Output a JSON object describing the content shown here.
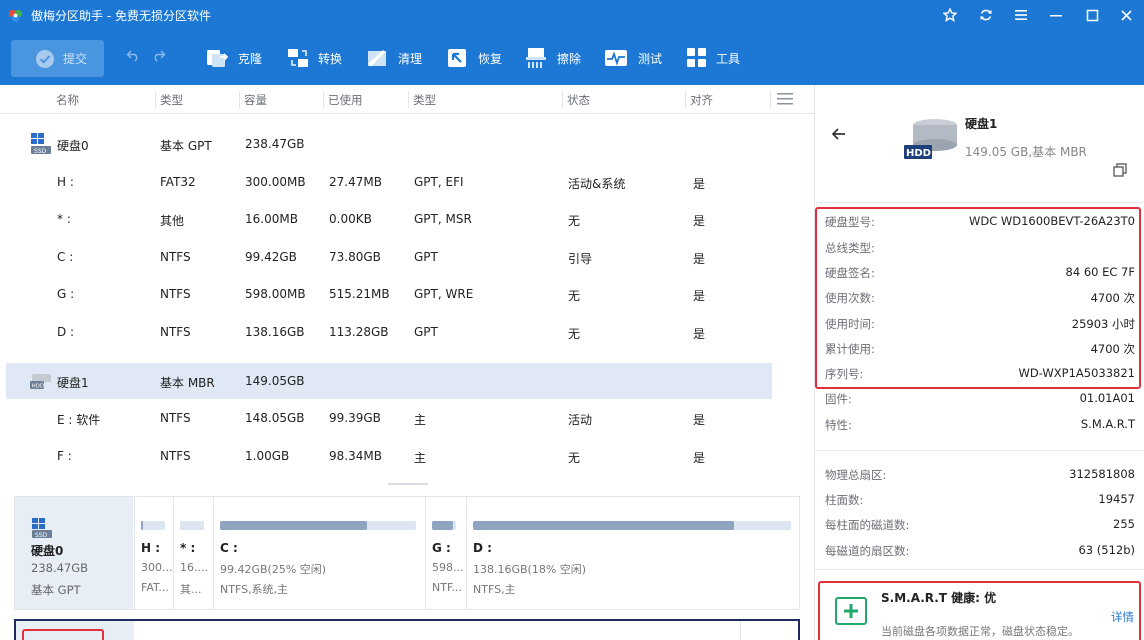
{
  "app": {
    "title": "傲梅分区助手 - 免费无损分区软件"
  },
  "colors": {
    "accent": "#1c78d4",
    "selected_row": "#dfe8f4",
    "highlight_red": "#e0303b",
    "smart_green": "#23a86b"
  },
  "toolbar": {
    "commit_label": "提交",
    "items": [
      {
        "label": "克隆",
        "icon": "clone-icon"
      },
      {
        "label": "转换",
        "icon": "convert-icon"
      },
      {
        "label": "清理",
        "icon": "cleanup-icon"
      },
      {
        "label": "恢复",
        "icon": "recover-icon"
      },
      {
        "label": "擦除",
        "icon": "wipe-icon"
      },
      {
        "label": "测试",
        "icon": "test-icon"
      },
      {
        "label": "工具",
        "icon": "tools-icon"
      }
    ]
  },
  "table": {
    "headers": [
      "名称",
      "类型",
      "容量",
      "已使用",
      "类型",
      "状态",
      "对齐"
    ],
    "rows": [
      {
        "name": "硬盘0",
        "type": "基本 GPT",
        "cap": "238.47GB",
        "used": "",
        "ptype": "",
        "status": "",
        "align": "",
        "disk": "ssd"
      },
      {
        "name": "H :",
        "type": "FAT32",
        "cap": "300.00MB",
        "used": "27.47MB",
        "ptype": "GPT, EFI",
        "status": "活动&系统",
        "align": "是"
      },
      {
        "name": "* :",
        "type": "其他",
        "cap": "16.00MB",
        "used": "0.00KB",
        "ptype": "GPT, MSR",
        "status": "无",
        "align": "是"
      },
      {
        "name": "C :",
        "type": "NTFS",
        "cap": "99.42GB",
        "used": "73.80GB",
        "ptype": "GPT",
        "status": "引导",
        "align": "是"
      },
      {
        "name": "G :",
        "type": "NTFS",
        "cap": "598.00MB",
        "used": "515.21MB",
        "ptype": "GPT, WRE",
        "status": "无",
        "align": "是"
      },
      {
        "name": "D :",
        "type": "NTFS",
        "cap": "138.16GB",
        "used": "113.28GB",
        "ptype": "GPT",
        "status": "无",
        "align": "是"
      },
      {
        "name": "硬盘1",
        "type": "基本 MBR",
        "cap": "149.05GB",
        "used": "",
        "ptype": "",
        "status": "",
        "align": "",
        "disk": "hdd"
      },
      {
        "name": "E : 软件",
        "type": "NTFS",
        "cap": "148.05GB",
        "used": "99.39GB",
        "ptype": "主",
        "status": "活动",
        "align": "是"
      },
      {
        "name": "F :",
        "type": "NTFS",
        "cap": "1.00GB",
        "used": "98.34MB",
        "ptype": "主",
        "status": "无",
        "align": "是"
      }
    ]
  },
  "diskmap": {
    "disk": {
      "name": "硬盘0",
      "size": "238.47GB",
      "type": "基本 GPT"
    },
    "partitions": [
      {
        "name": "H :",
        "size": "300...",
        "fs": "FAT...",
        "used_fraction": 0.09
      },
      {
        "name": "* :",
        "size": "16....",
        "fs": "其...",
        "used_fraction": 0.0
      },
      {
        "name": "C :",
        "size": "99.42GB(25% 空闲)",
        "fs": "NTFS,系统,主",
        "used_fraction": 0.75
      },
      {
        "name": "G :",
        "size": "598...",
        "fs": "NTF...",
        "used_fraction": 0.86
      },
      {
        "name": "D :",
        "size": "138.16GB(18% 空闲)",
        "fs": "NTFS,主",
        "used_fraction": 0.82
      }
    ]
  },
  "details": {
    "disk_name": "硬盘1",
    "disk_summary": "149.05 GB,基本 MBR",
    "hdd_badge": "HDD",
    "props": [
      {
        "k": "硬盘型号:",
        "v": "WDC WD1600BEVT-26A23T0"
      },
      {
        "k": "总线类型:",
        "v": ""
      },
      {
        "k": "硬盘签名:",
        "v": "84 60 EC 7F"
      },
      {
        "k": "使用次数:",
        "v": "4700 次"
      },
      {
        "k": "使用时间:",
        "v": "25903 小时"
      },
      {
        "k": "累计使用:",
        "v": "4700 次"
      },
      {
        "k": "序列号:",
        "v": "WD-WXP1A5033821"
      },
      {
        "k": "固件:",
        "v": "01.01A01"
      },
      {
        "k": "特性:",
        "v": "S.M.A.R.T"
      }
    ],
    "props2": [
      {
        "k": "物理总扇区:",
        "v": "312581808"
      },
      {
        "k": "柱面数:",
        "v": "19457"
      },
      {
        "k": "每柱面的磁道数:",
        "v": "255"
      },
      {
        "k": "每磁道的扇区数:",
        "v": "63 (512b)"
      }
    ],
    "smart_title": "S.M.A.R.T 健康: 优",
    "smart_desc": "当前磁盘各项数据正常，磁盘状态稳定。",
    "smart_link": "详情"
  }
}
